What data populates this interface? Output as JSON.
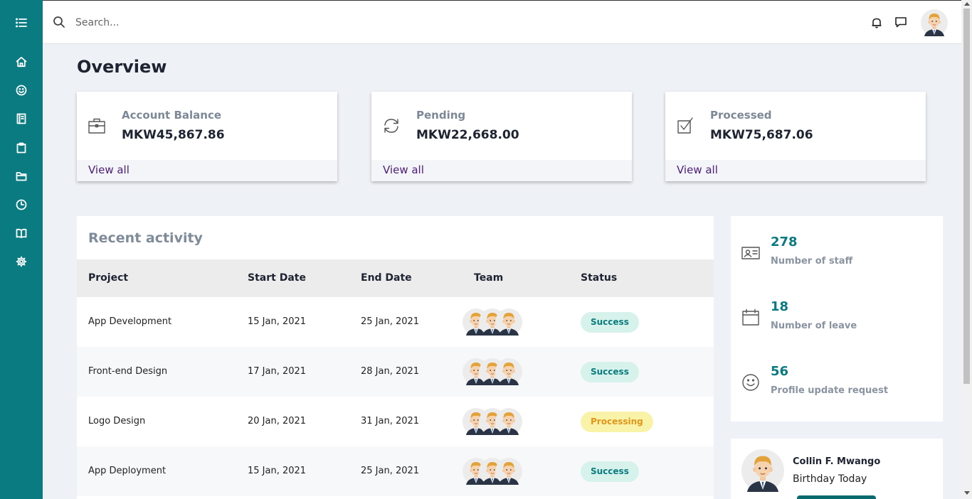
{
  "topbar": {
    "search_placeholder": "Search..."
  },
  "sidebar": {
    "items": [
      {
        "icon": "list-icon"
      },
      {
        "icon": "home-icon"
      },
      {
        "icon": "smiley-icon"
      },
      {
        "icon": "book-icon"
      },
      {
        "icon": "clipboard-icon"
      },
      {
        "icon": "folder-icon"
      },
      {
        "icon": "clock-icon"
      },
      {
        "icon": "open-book-icon"
      },
      {
        "icon": "gear-icon"
      }
    ]
  },
  "overview": {
    "title": "Overview",
    "cards": [
      {
        "icon": "briefcase-icon",
        "label": "Account Balance",
        "value": "MKW45,867.86",
        "link": "View all"
      },
      {
        "icon": "refresh-icon",
        "label": "Pending",
        "value": "MKW22,668.00",
        "link": "View all"
      },
      {
        "icon": "checkbox-icon",
        "label": "Processed",
        "value": "MKW75,687.06",
        "link": "View all"
      }
    ]
  },
  "activity": {
    "title": "Recent activity",
    "columns": [
      "Project",
      "Start Date",
      "End Date",
      "Team",
      "Status"
    ],
    "rows": [
      {
        "project": "App Development",
        "start": "15 Jan, 2021",
        "end": "25 Jan, 2021",
        "status": "Success"
      },
      {
        "project": "Front-end Design",
        "start": "17 Jan, 2021",
        "end": "28 Jan, 2021",
        "status": "Success"
      },
      {
        "project": "Logo Design",
        "start": "20 Jan, 2021",
        "end": "31 Jan, 2021",
        "status": "Processing"
      },
      {
        "project": "App Deployment",
        "start": "15 Jan, 2021",
        "end": "25 Jan, 2021",
        "status": "Success"
      }
    ]
  },
  "stats": [
    {
      "icon": "id-card-icon",
      "number": "278",
      "label": "Number of staff"
    },
    {
      "icon": "calendar-icon",
      "number": "18",
      "label": "Number of leave"
    },
    {
      "icon": "smiley-icon",
      "number": "56",
      "label": "Profile update request"
    }
  ],
  "birthday": {
    "name": "Collin F. Mwango",
    "subtitle": "Birthday Today"
  },
  "colors": {
    "sidebar": "#0a7b80",
    "accent_number": "#0a7b80",
    "link": "#4b1d7a",
    "success_bg": "#d6f2ea",
    "processing_bg": "#f8f3a8"
  }
}
